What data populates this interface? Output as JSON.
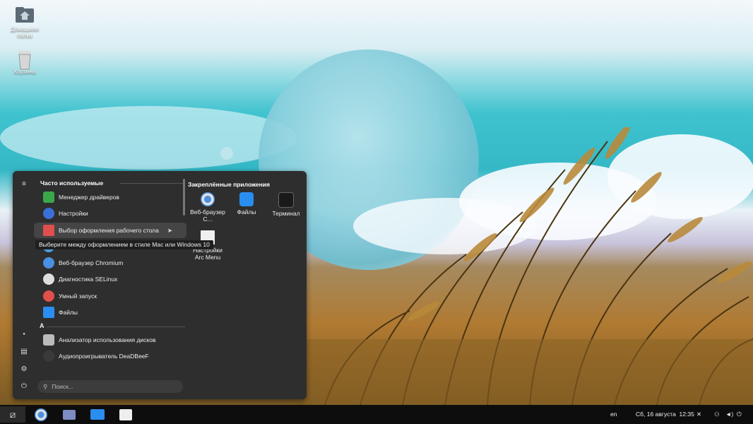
{
  "desktop": {
    "icons": [
      {
        "label": "Домашняя папка"
      },
      {
        "label": "Корзина"
      }
    ]
  },
  "menu": {
    "frequent_header": "Часто используемые",
    "pinned_header": "Закреплённые приложения",
    "frequent_items": [
      {
        "label": "Менеджер драйверов",
        "icon": "driver-manager-icon",
        "color": "#3aa84a"
      },
      {
        "label": "Настройки",
        "icon": "settings-icon",
        "color": "#3b6fd6"
      },
      {
        "label": "Выбор оформления рабочего стола",
        "icon": "desktop-layout-icon",
        "color": "#e04e4e"
      },
      {
        "label": "",
        "icon": "hidden-app-icon",
        "color": "#4aa0e0"
      },
      {
        "label": "Веб-браузер Chromium",
        "icon": "chromium-icon",
        "color": "#4a90e2"
      },
      {
        "label": "Диагностика SELinux",
        "icon": "selinux-icon",
        "color": "#dddddd"
      },
      {
        "label": "Умный запуск",
        "icon": "smart-launch-icon",
        "color": "#e0504a"
      },
      {
        "label": "Файлы",
        "icon": "folder-icon",
        "color": "#2a8df0"
      }
    ],
    "section_letter": "А",
    "a_items": [
      {
        "label": "Анализатор использования дисков",
        "icon": "disk-usage-icon",
        "color": "#bbbbbb"
      },
      {
        "label": "Аудиопроигрыватель DeaDBeeF",
        "icon": "deadbeef-icon",
        "color": "#3a3a3a"
      }
    ],
    "pinned": [
      {
        "label": "Веб-браузер C...",
        "icon": "chromium-icon"
      },
      {
        "label": "Файлы",
        "icon": "folder-icon"
      },
      {
        "label": "Терминал",
        "icon": "terminal-icon"
      },
      {
        "label": "Настройки Arc Menu",
        "icon": "arc-menu-icon"
      }
    ],
    "search_placeholder": "Поиск...",
    "tooltip": "Выберите между оформлением в стиле Mac или Windows 10"
  },
  "taskbar": {
    "lang": "en",
    "datetime": "Сб, 16 августа  12:35"
  }
}
